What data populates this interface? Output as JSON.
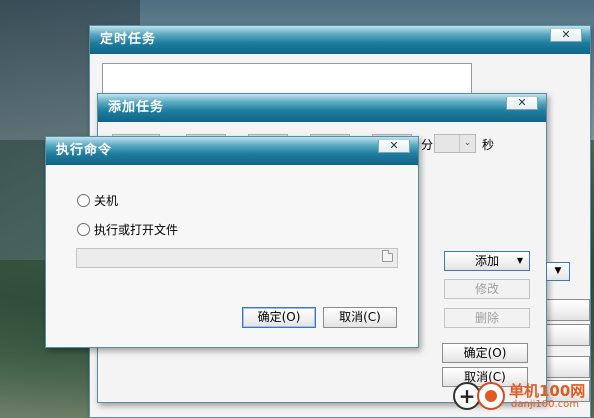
{
  "timer_window": {
    "title": "定时任务",
    "close_glyph": "✕",
    "ok_label": "确定(O)",
    "cancel_label": "取消(C)"
  },
  "add_window": {
    "title": "添加任务",
    "close_glyph": "✕",
    "second_unit": "秒",
    "minute_unit_partial": "分",
    "add_button": "添加",
    "modify_button": "修改",
    "delete_button": "删除",
    "dropdown_arrow": "▼"
  },
  "exec_window": {
    "title": "执行命令",
    "close_glyph": "✕",
    "radio_shutdown": "关机",
    "radio_open_file": "执行或打开文件",
    "file_path_value": "",
    "ok_button": "确定(O)",
    "cancel_button": "取消(C)"
  },
  "watermark": {
    "brand": "单机100网",
    "domain": "danji100.com",
    "plus_glyph": "+"
  }
}
